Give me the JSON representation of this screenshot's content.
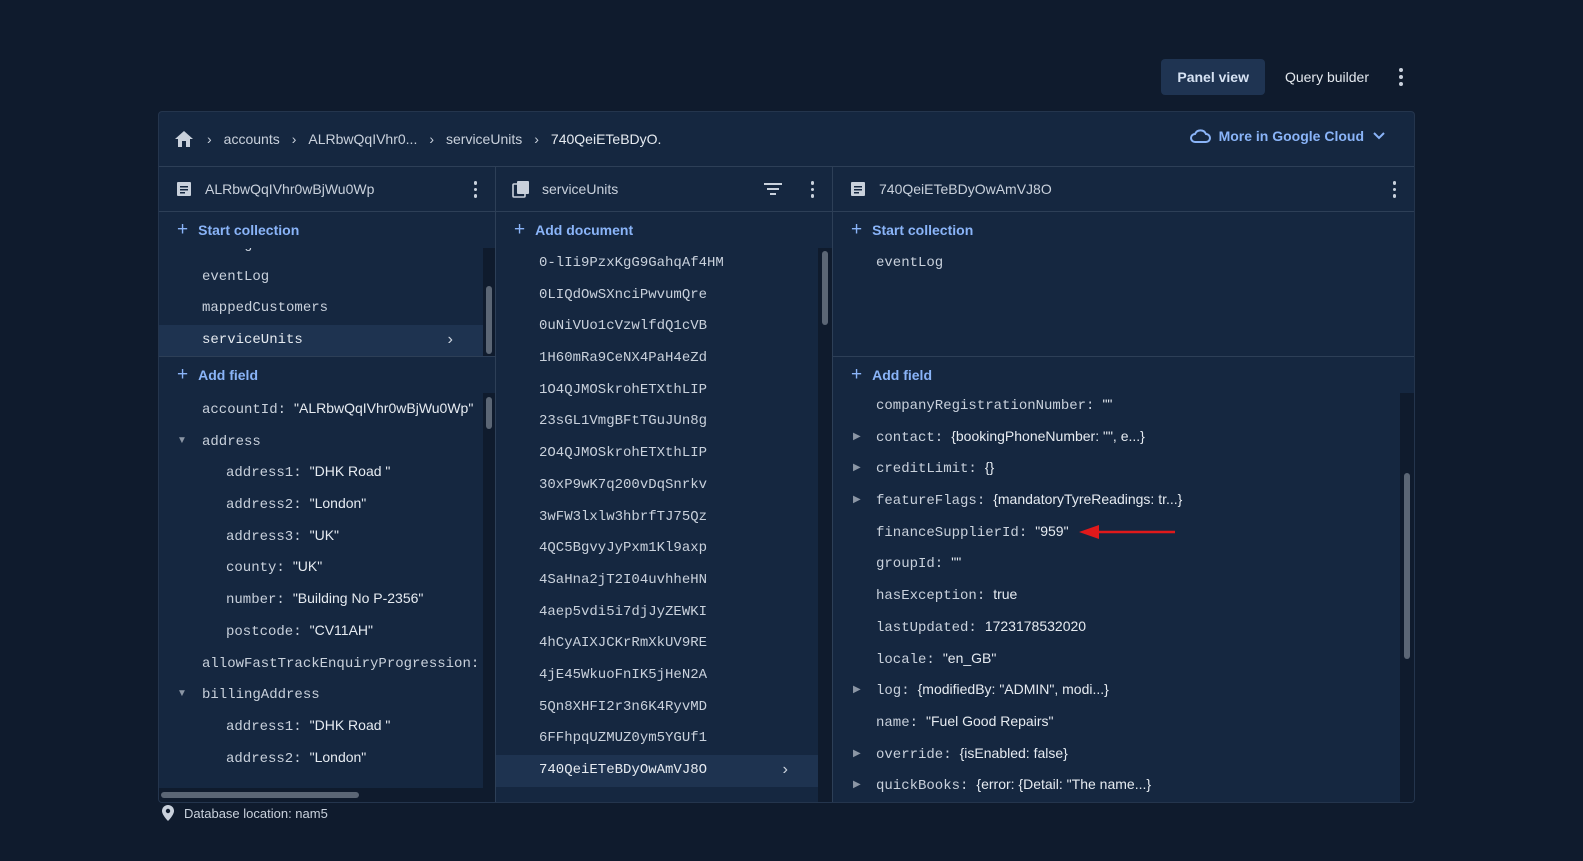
{
  "topbar": {
    "panel_view": "Panel view",
    "query_builder": "Query builder"
  },
  "breadcrumb": {
    "items": [
      "accounts",
      "ALRbwQqIVhr0...",
      "serviceUnits",
      "740QeiETeBDyO."
    ],
    "more_in_cloud": "More in Google Cloud"
  },
  "col1": {
    "title": "ALRbwQqIVhr0wBjWu0Wp",
    "start_collection": "Start collection",
    "collections": [
      "config",
      "eventLog",
      "mappedCustomers",
      "serviceUnits"
    ],
    "add_field": "Add field",
    "fields": [
      {
        "key": "accountId:",
        "value": "\"ALRbwQqIVhr0wBjWu0Wp\""
      },
      {
        "key": "address",
        "value": ""
      },
      {
        "key": "address1:",
        "value": "\"DHK Road \""
      },
      {
        "key": "address2:",
        "value": "\"London\""
      },
      {
        "key": "address3:",
        "value": "\"UK\""
      },
      {
        "key": "county:",
        "value": "\"UK\""
      },
      {
        "key": "number:",
        "value": "\"Building No P-2356\""
      },
      {
        "key": "postcode:",
        "value": "\"CV11AH\""
      },
      {
        "key": "allowFastTrackEnquiryProgression:",
        "value": ""
      },
      {
        "key": "billingAddress",
        "value": ""
      },
      {
        "key": "address1:",
        "value": "\"DHK Road \""
      },
      {
        "key": "address2:",
        "value": "\"London\""
      }
    ]
  },
  "col2": {
    "title": "serviceUnits",
    "add_document": "Add document",
    "documents": [
      "0-lIi9PzxKgG9GahqAf4HM",
      "0LIQdOwSXnciPwvumQre",
      "0uNiVUo1cVzwlfdQ1cVB",
      "1H60mRa9CeNX4PaH4eZd",
      "1O4QJMOSkrohETXthLIP",
      "23sGL1VmgBFtTGuJUn8g",
      "2O4QJMOSkrohETXthLIP",
      "30xP9wK7q200vDqSnrkv",
      "3wFW3lxlw3hbrfTJ75Qz",
      "4QC5BgvyJyPxm1Kl9axp",
      "4SaHna2jT2I04uvhheHN",
      "4aep5vdi5i7djJyZEWKI",
      "4hCyAIXJCKrRmXkUV9RE",
      "4jE45WkuoFnIK5jHeN2A",
      "5Qn8XHFI2r3n6K4RyvMD",
      "6FFhpqUZMUZ0ym5YGUf1",
      "740QeiETeBDyOwAmVJ8O"
    ]
  },
  "col3": {
    "title": "740QeiETeBDyOwAmVJ8O",
    "start_collection": "Start collection",
    "collections": [
      "eventLog"
    ],
    "add_field": "Add field",
    "fields": [
      {
        "key": "companyRegistrationNumber:",
        "value": "\"\""
      },
      {
        "key": "contact:",
        "value": "{bookingPhoneNumber: \"\", e...}"
      },
      {
        "key": "creditLimit:",
        "value": "{}"
      },
      {
        "key": "featureFlags:",
        "value": "{mandatoryTyreReadings: tr...}"
      },
      {
        "key": "financeSupplierId:",
        "value": "\"959\""
      },
      {
        "key": "groupId:",
        "value": "\"\""
      },
      {
        "key": "hasException:",
        "value": "true"
      },
      {
        "key": "lastUpdated:",
        "value": "1723178532020"
      },
      {
        "key": "locale:",
        "value": "\"en_GB\""
      },
      {
        "key": "log:",
        "value": "{modifiedBy: \"ADMIN\", modi...}"
      },
      {
        "key": "name:",
        "value": "\"Fuel Good Repairs\""
      },
      {
        "key": "override:",
        "value": "{isEnabled: false}"
      },
      {
        "key": "quickBooks:",
        "value": "{error: {Detail: \"The name...}"
      }
    ]
  },
  "footer": {
    "location": "Database location: nam5"
  },
  "colors": {
    "bg": "#0f1b2d",
    "panel": "#152740",
    "accent": "#8ab4f8",
    "arrow": "#e0191b"
  }
}
